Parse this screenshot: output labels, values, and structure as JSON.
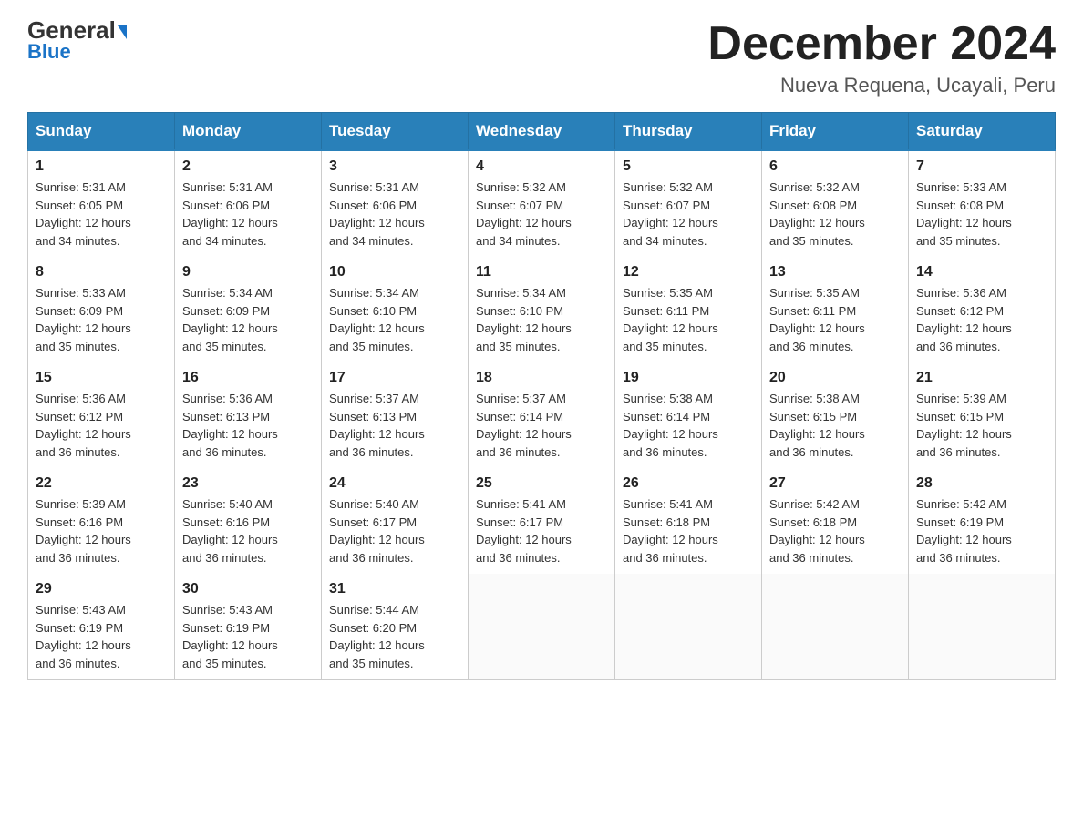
{
  "header": {
    "logo_general": "General",
    "logo_blue": "Blue",
    "month_title": "December 2024",
    "location": "Nueva Requena, Ucayali, Peru"
  },
  "days_of_week": [
    "Sunday",
    "Monday",
    "Tuesday",
    "Wednesday",
    "Thursday",
    "Friday",
    "Saturday"
  ],
  "weeks": [
    [
      {
        "day": "1",
        "sunrise": "5:31 AM",
        "sunset": "6:05 PM",
        "daylight": "12 hours and 34 minutes."
      },
      {
        "day": "2",
        "sunrise": "5:31 AM",
        "sunset": "6:06 PM",
        "daylight": "12 hours and 34 minutes."
      },
      {
        "day": "3",
        "sunrise": "5:31 AM",
        "sunset": "6:06 PM",
        "daylight": "12 hours and 34 minutes."
      },
      {
        "day": "4",
        "sunrise": "5:32 AM",
        "sunset": "6:07 PM",
        "daylight": "12 hours and 34 minutes."
      },
      {
        "day": "5",
        "sunrise": "5:32 AM",
        "sunset": "6:07 PM",
        "daylight": "12 hours and 34 minutes."
      },
      {
        "day": "6",
        "sunrise": "5:32 AM",
        "sunset": "6:08 PM",
        "daylight": "12 hours and 35 minutes."
      },
      {
        "day": "7",
        "sunrise": "5:33 AM",
        "sunset": "6:08 PM",
        "daylight": "12 hours and 35 minutes."
      }
    ],
    [
      {
        "day": "8",
        "sunrise": "5:33 AM",
        "sunset": "6:09 PM",
        "daylight": "12 hours and 35 minutes."
      },
      {
        "day": "9",
        "sunrise": "5:34 AM",
        "sunset": "6:09 PM",
        "daylight": "12 hours and 35 minutes."
      },
      {
        "day": "10",
        "sunrise": "5:34 AM",
        "sunset": "6:10 PM",
        "daylight": "12 hours and 35 minutes."
      },
      {
        "day": "11",
        "sunrise": "5:34 AM",
        "sunset": "6:10 PM",
        "daylight": "12 hours and 35 minutes."
      },
      {
        "day": "12",
        "sunrise": "5:35 AM",
        "sunset": "6:11 PM",
        "daylight": "12 hours and 35 minutes."
      },
      {
        "day": "13",
        "sunrise": "5:35 AM",
        "sunset": "6:11 PM",
        "daylight": "12 hours and 36 minutes."
      },
      {
        "day": "14",
        "sunrise": "5:36 AM",
        "sunset": "6:12 PM",
        "daylight": "12 hours and 36 minutes."
      }
    ],
    [
      {
        "day": "15",
        "sunrise": "5:36 AM",
        "sunset": "6:12 PM",
        "daylight": "12 hours and 36 minutes."
      },
      {
        "day": "16",
        "sunrise": "5:36 AM",
        "sunset": "6:13 PM",
        "daylight": "12 hours and 36 minutes."
      },
      {
        "day": "17",
        "sunrise": "5:37 AM",
        "sunset": "6:13 PM",
        "daylight": "12 hours and 36 minutes."
      },
      {
        "day": "18",
        "sunrise": "5:37 AM",
        "sunset": "6:14 PM",
        "daylight": "12 hours and 36 minutes."
      },
      {
        "day": "19",
        "sunrise": "5:38 AM",
        "sunset": "6:14 PM",
        "daylight": "12 hours and 36 minutes."
      },
      {
        "day": "20",
        "sunrise": "5:38 AM",
        "sunset": "6:15 PM",
        "daylight": "12 hours and 36 minutes."
      },
      {
        "day": "21",
        "sunrise": "5:39 AM",
        "sunset": "6:15 PM",
        "daylight": "12 hours and 36 minutes."
      }
    ],
    [
      {
        "day": "22",
        "sunrise": "5:39 AM",
        "sunset": "6:16 PM",
        "daylight": "12 hours and 36 minutes."
      },
      {
        "day": "23",
        "sunrise": "5:40 AM",
        "sunset": "6:16 PM",
        "daylight": "12 hours and 36 minutes."
      },
      {
        "day": "24",
        "sunrise": "5:40 AM",
        "sunset": "6:17 PM",
        "daylight": "12 hours and 36 minutes."
      },
      {
        "day": "25",
        "sunrise": "5:41 AM",
        "sunset": "6:17 PM",
        "daylight": "12 hours and 36 minutes."
      },
      {
        "day": "26",
        "sunrise": "5:41 AM",
        "sunset": "6:18 PM",
        "daylight": "12 hours and 36 minutes."
      },
      {
        "day": "27",
        "sunrise": "5:42 AM",
        "sunset": "6:18 PM",
        "daylight": "12 hours and 36 minutes."
      },
      {
        "day": "28",
        "sunrise": "5:42 AM",
        "sunset": "6:19 PM",
        "daylight": "12 hours and 36 minutes."
      }
    ],
    [
      {
        "day": "29",
        "sunrise": "5:43 AM",
        "sunset": "6:19 PM",
        "daylight": "12 hours and 36 minutes."
      },
      {
        "day": "30",
        "sunrise": "5:43 AM",
        "sunset": "6:19 PM",
        "daylight": "12 hours and 35 minutes."
      },
      {
        "day": "31",
        "sunrise": "5:44 AM",
        "sunset": "6:20 PM",
        "daylight": "12 hours and 35 minutes."
      },
      null,
      null,
      null,
      null
    ]
  ],
  "labels": {
    "sunrise": "Sunrise:",
    "sunset": "Sunset:",
    "daylight": "Daylight:"
  }
}
